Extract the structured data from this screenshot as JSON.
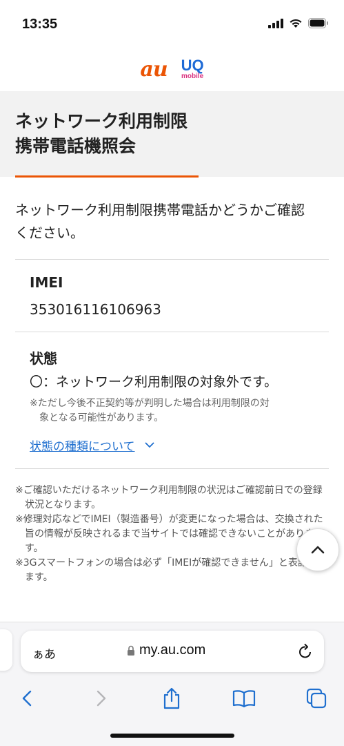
{
  "status_bar": {
    "time": "13:35"
  },
  "header": {
    "au_logo": "au",
    "uq_logo_main": "UQ",
    "uq_logo_sub": "mobile"
  },
  "page": {
    "title": "ネットワーク利用制限\n携帯電話機照会",
    "intro": "ネットワーク利用制限携帯電話かどうかご確認\nください。"
  },
  "imei": {
    "label": "IMEI",
    "value": "353016116106963"
  },
  "status": {
    "label": "状態",
    "value": "〇：ネットワーク利用制限の対象外です。",
    "note": "※ただし今後不正契約等が判明した場合は利用制限の対\n　象となる可能性があります。",
    "link": "状態の種類について"
  },
  "notes": [
    "※ご確認いただけるネットワーク利用制限の状況はご確認前日での登録状況となります。",
    "※修理対応などでIMEI（製造番号）が変更になった場合は、交換された旨の情報が反映されるまで当サイトでは確認できないことがあります。",
    "※3Gスマートフォンの場合は必ず「IMEIが確認できません」と表記されます。"
  ],
  "browser": {
    "aa_label": "ぁあ",
    "url": "my.au.com"
  },
  "colors": {
    "accent": "#eb5505",
    "link": "#1f6fcf",
    "title_bg": "#f2f2f2"
  }
}
